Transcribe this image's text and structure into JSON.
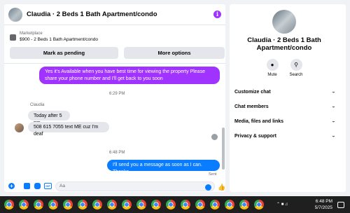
{
  "header": {
    "title": "Claudia · 2 Beds 1 Bath Apartment/condo",
    "info_icon": "info-icon"
  },
  "marketplace": {
    "label": "Marketplace",
    "listing": "$900 - 2 Beds 1 Bath Apartment/condo"
  },
  "actions": {
    "pending_label": "Mark as pending",
    "options_label": "More options"
  },
  "messages": {
    "outgoing_1": "Yes it's Available when you have best time for viewing the property Please share your phone number and I'll get back to you soon",
    "time_1": "6:29 PM",
    "sender": "Claudia",
    "incoming_1": "Today after 5 pm",
    "incoming_2": "508 615 7055 text ME cuz I'm deaf",
    "time_2": "6:48 PM",
    "outgoing_2": "I'll send you a message as soon as I can. Thanks",
    "sent_status": "Sent"
  },
  "composer": {
    "placeholder": "Aa",
    "gif_label": "GIF"
  },
  "info_panel": {
    "name": "Claudia · 2 Beds 1 Bath Apartment/condo",
    "mute_label": "Mute",
    "search_label": "Search",
    "sections": [
      "Customize chat",
      "Chat members",
      "Media, files and links",
      "Privacy & support"
    ]
  },
  "taskbar": {
    "time": "6:48 PM",
    "date": "5/7/2025"
  },
  "colors": {
    "purple_bubble": "#a033ff",
    "blue_bubble": "#0a7cff",
    "incoming_bubble": "#e4e6eb"
  }
}
